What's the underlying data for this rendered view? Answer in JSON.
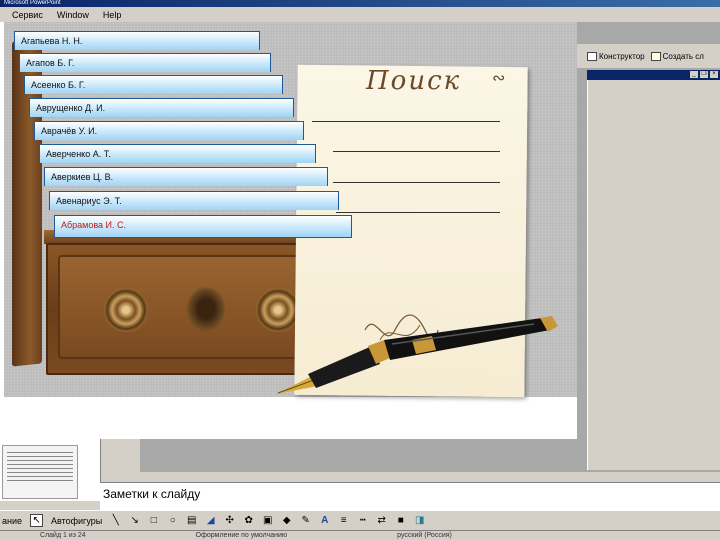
{
  "window": {
    "title": "Microsoft PowerPoint"
  },
  "menu": [
    "Сервис",
    "Window",
    "Help"
  ],
  "right_toolbar": {
    "designer": "Конструктор",
    "create_slide": "Создать сл"
  },
  "slide": {
    "paper_title": "Поиск",
    "cards": [
      {
        "label": "Агапьева Н. Н.",
        "active": false
      },
      {
        "label": "Агапов Б. Г.",
        "active": false
      },
      {
        "label": "Асеенко Б. Г.",
        "active": false
      },
      {
        "label": "Аврущенко Д. И.",
        "active": false
      },
      {
        "label": "Аврачёв У. И.",
        "active": false
      },
      {
        "label": "Аверченко А. Т.",
        "active": false
      },
      {
        "label": "Аверкиев Ц. В.",
        "active": false
      },
      {
        "label": "Авенариус Э. Т.",
        "active": false
      },
      {
        "label": "Абрамова И. С.",
        "active": true
      }
    ]
  },
  "notes": {
    "placeholder": "Заметки к слайду"
  },
  "drawing_toolbar": {
    "draw_label": "ание",
    "autoshapes_label": "Автофигуры"
  },
  "status": {
    "slide": "Слайд 1 из 24",
    "design": "Оформление по умолчанию",
    "language": "русский (Россия)"
  },
  "colors": {
    "card_border": "#1e5a9a",
    "active_card_text": "#c01818",
    "wood": "#7a4a22",
    "paper": "#f8f0dc"
  },
  "icons": [
    "select-arrow-icon",
    "line-icon",
    "arrow-icon",
    "rectangle-icon",
    "oval-icon",
    "textbox-icon",
    "wordart-icon",
    "diagram-icon",
    "clipart-icon",
    "picture-icon",
    "fill-color-icon",
    "line-color-icon",
    "font-color-icon",
    "line-style-icon",
    "dash-style-icon",
    "arrow-style-icon",
    "shadow-icon",
    "3d-icon"
  ]
}
